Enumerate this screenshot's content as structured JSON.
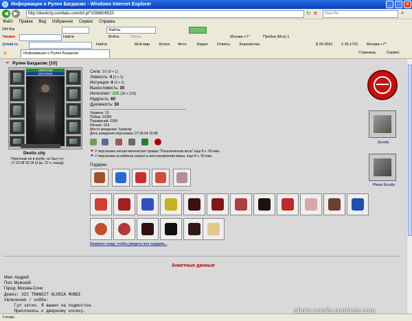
{
  "window": {
    "title": "Информация о Рулен Багдасмс - Windows Internet Explorer",
    "min": "_",
    "max": "□",
    "close": "×"
  },
  "address": {
    "url": "http://dev4city.combats.com/inf.pl?1086606520",
    "search_placeholder": "Mail.Ru"
  },
  "menu": {
    "items": [
      "Файл",
      "Правка",
      "Вид",
      "Избранное",
      "Сервис",
      "Справка"
    ]
  },
  "toolbar1": {
    "dm": "DM Bar",
    "files": "Файлы",
    "login": "Войти",
    "mail": "Почта",
    "hint": "Найти",
    "weather": "Москва +7°",
    "traffic": "Пробки (Мск) 1"
  },
  "toolbar2": {
    "yandex": "Yandex",
    "find": "Найти",
    "moscow": "Москва +7°",
    "rate1": "$ 26.0561",
    "rate2": "€ 35.1731"
  },
  "toolbar3": {
    "mailru": "@mail.ru",
    "find": "Найти",
    "world": "Мой мир",
    "blogs": "Блоги",
    "photo": "Фото",
    "video": "Видео",
    "answers": "Ответы",
    "friends": "Знакомства"
  },
  "tab": {
    "label": "Информация о Рулен Багдасмс",
    "page": "Страница",
    "service": "Сервис"
  },
  "char": {
    "name": "Рулен Багдасмс [10]",
    "hp": "1968/1968",
    "mana": "2347/2315",
    "city": "Devils city",
    "offline": "Персонаж не в клубе, но был тут:",
    "lastseen": "17.10.08 03:18 (3 дн. 22 ч. назад)"
  },
  "stats": [
    {
      "label": "Сила:",
      "value": "10",
      "extra": "(9 + 1)"
    },
    {
      "label": "Ловкость:",
      "value": "4",
      "extra": "(3 + 1)"
    },
    {
      "label": "Интуиция:",
      "value": "4",
      "extra": "(3 + 1)"
    },
    {
      "label": "Выносливость:",
      "value": "30",
      "extra": ""
    },
    {
      "label": "Интеллект:",
      "value": "235",
      "extra": "(16 + 219)"
    },
    {
      "label": "Мудрость:",
      "value": "60",
      "extra": ""
    },
    {
      "label": "Духовность:",
      "value": "50",
      "extra": ""
    }
  ],
  "info": [
    "Уровень: 10",
    "Побед: 10369",
    "Поражений: 2365",
    "Ничьих: 104",
    "Место рождения: Sandcity",
    "День рождения персонажа: 07.06.04 15:08"
  ],
  "effects": {
    "line1": "У персонажа легкая магическая травма \"Покалеченная воля\" еще 8 ч. 50 мин.",
    "line2": "У персонажа ослаблена скорость восстановления маны, еще 8 ч. 50 мин."
  },
  "gifts": {
    "label": "Подарки:",
    "more": "Нажмите сюда, чтобы увидеть все подарки..."
  },
  "profile": {
    "heading": "Анкетные данные",
    "lines": [
      "Имя: Андрей",
      "Пол: Мужской",
      "Город: Москва-Сочи",
      "Девиз: SIC TRANSIT GLORIA MUNDI",
      "Увлечения / хобби:",
      "    Гул затих. Я вышел на подмостки.",
      "    Прислонясь к дверному косяку."
    ]
  },
  "side": {
    "scrolls": "Scrolls",
    "photo": "Photo Scrolls"
  },
  "status": {
    "left": "Готово"
  },
  "watermark": "photo.scrolls.combats.com",
  "colors": {
    "accent": "#b00000",
    "green": "#1e8c1e",
    "blue": "#1c3f94"
  }
}
